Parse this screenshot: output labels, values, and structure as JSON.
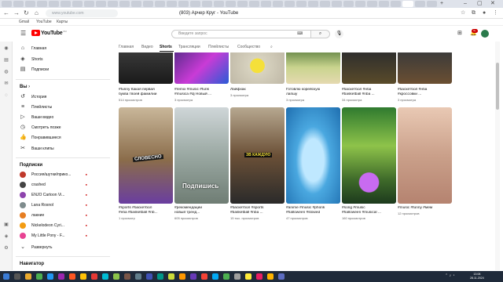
{
  "browser": {
    "url": "www.youtube.com",
    "page_title": "(803) Арчер Круг - YouTube",
    "bookmarks": [
      "Gmail",
      "YouTube",
      "Карты"
    ]
  },
  "youtube": {
    "logo_text": "YouTube",
    "logo_country": "RU",
    "search_placeholder": "Введите запрос",
    "notifications_count": "9+",
    "chips": [
      "Главная",
      "Видео",
      "Shorts",
      "Трансляции",
      "Плейлисты",
      "Сообщество"
    ],
    "active_chip": "Shorts"
  },
  "sidebar": {
    "main": [
      {
        "label": "Главная",
        "icon": "home-icon"
      },
      {
        "label": "Shorts",
        "icon": "shorts-icon"
      },
      {
        "label": "Подписки",
        "icon": "subscriptions-icon"
      }
    ],
    "you_header": "Вы",
    "you_items": [
      {
        "label": "История",
        "icon": "history-icon"
      },
      {
        "label": "Плейлисты",
        "icon": "playlists-icon"
      },
      {
        "label": "Ваши видео",
        "icon": "your-videos-icon"
      },
      {
        "label": "Смотреть позже",
        "icon": "watch-later-icon"
      },
      {
        "label": "Понравившиеся",
        "icon": "liked-icon"
      },
      {
        "label": "Ваши клипы",
        "icon": "clips-icon"
      }
    ],
    "subs_header": "Подписки",
    "subs": [
      {
        "label": "Россия/шутки/прико...",
        "color": "#c0392b"
      },
      {
        "label": "crashed",
        "color": "#444444"
      },
      {
        "label": "ENJO Cartoon Vi...",
        "color": "#8e44ad"
      },
      {
        "label": "Lana Rosnol",
        "color": "#7f8c8d"
      },
      {
        "label": "лакние",
        "color": "#e67e22"
      },
      {
        "label": "Nickelodeon Cyri...",
        "color": "#f39c12"
      },
      {
        "label": "My Little Pony - F...",
        "color": "#e84393"
      }
    ],
    "expand_label": "Развернуть",
    "navigator_header": "Навигатор"
  },
  "top_row": [
    {
      "title": "#funny Какая первая",
      "title2": "буква твоей фамилии",
      "views": "514 просмотров"
    },
    {
      "title": "#remix #music #funk",
      "title2": "#musica #dj Новый ...",
      "views": "3 просмотра"
    },
    {
      "title": "Лайфхак",
      "title2": "",
      "views": "3 просмотра"
    },
    {
      "title": "Готовлю корейскую",
      "title2": "лапшу",
      "views": "3 просмотра"
    },
    {
      "title": "#баскетбол #нба",
      "title2": "#basketball #nba ...",
      "views": "34 просмотра"
    },
    {
      "title": "#баскетбол #нба",
      "title2": "#кроссовки ...",
      "views": "3 просмотра"
    }
  ],
  "bottom_row": [
    {
      "title": "#sports #баскетбол",
      "title2": "#нба #basketball #nb...",
      "views": "1 просмотр",
      "overlay": "СЛОВЕСНО"
    },
    {
      "title": "#рекомендации",
      "title2": "новый тренд...",
      "views": "605 просмотров",
      "overlay": "Подпишись"
    },
    {
      "title": "#баскетбол #sports",
      "title2": "#basketball #nba ...",
      "views": "15 тыс. просмотров",
      "overlay": "ЗВ КАЖДУЮ"
    },
    {
      "title": "#anime #music #phonk",
      "title2": "#halloween #slowed",
      "views": "47 просмотров",
      "overlay": ""
    },
    {
      "title": "#song #music",
      "title2": "#halloween #musical ...",
      "views": "160 просмотров",
      "overlay": ""
    },
    {
      "title": "#music #funny #мем",
      "title2": "",
      "views": "12 просмотров",
      "overlay": ""
    }
  ],
  "taskbar": {
    "time": "13:08",
    "date": "28.11.2024"
  }
}
